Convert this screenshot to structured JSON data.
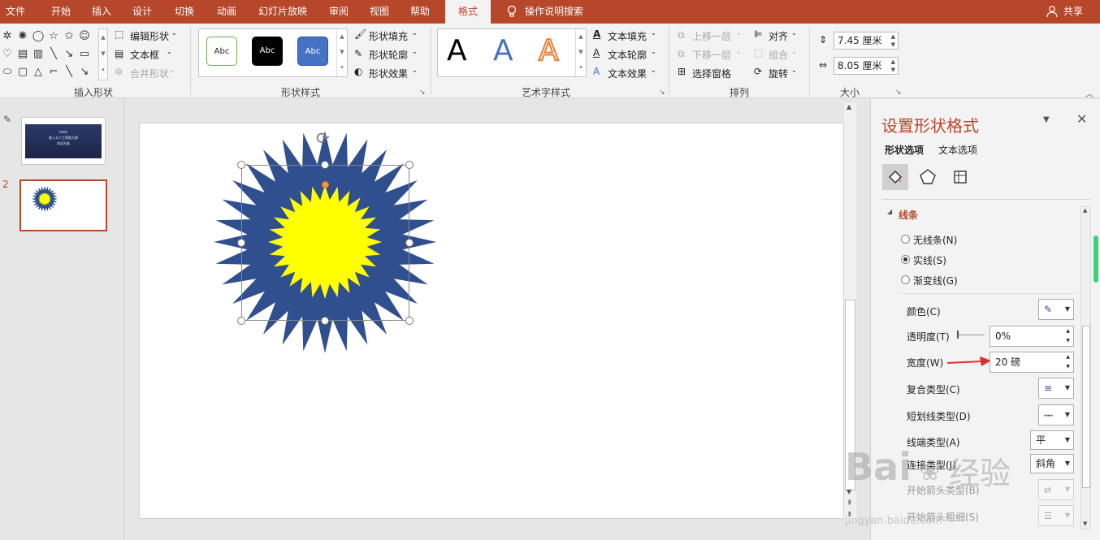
{
  "menu": {
    "items": [
      "文件",
      "开始",
      "插入",
      "设计",
      "切换",
      "动画",
      "幻灯片放映",
      "审阅",
      "视图",
      "帮助",
      "格式"
    ],
    "active": "格式",
    "search": "操作说明搜索",
    "share": "共享"
  },
  "ribbon": {
    "insert_shapes": {
      "label": "插入形状",
      "edit_shape": "编辑形状",
      "text_box": "文本框",
      "merge_shapes": "合并形状"
    },
    "shape_styles": {
      "label": "形状样式",
      "samples": [
        "Abc",
        "Abc",
        "Abc"
      ],
      "fill": "形状填充",
      "outline": "形状轮廓",
      "effects": "形状效果"
    },
    "wordart": {
      "label": "艺术字样式",
      "samples": [
        "A",
        "A",
        "A"
      ],
      "text_fill": "文本填充",
      "text_outline": "文本轮廓",
      "text_effects": "文本效果"
    },
    "arrange": {
      "label": "排列",
      "bring_forward": "上移一层",
      "send_backward": "下移一层",
      "selection_pane": "选择窗格",
      "align": "对齐",
      "group": "组合",
      "rotate": "旋转"
    },
    "size": {
      "label": "大小",
      "height": "7.45 厘米",
      "width": "8.05 厘米"
    }
  },
  "slides": {
    "thumb1_text": "Hello\n嵌入式人工智能大赛\n欢迎光临",
    "current_number": "2"
  },
  "panel": {
    "title": "设置形状格式",
    "tabs": [
      "形状选项",
      "文本选项"
    ],
    "section": "线条",
    "radios": [
      "无线条(N)",
      "实线(S)",
      "渐变线(G)"
    ],
    "selected_radio": "实线(S)",
    "color_label": "颜色(C)",
    "transparency_label": "透明度(T)",
    "transparency_value": "0%",
    "width_label": "宽度(W)",
    "width_value": "20 磅",
    "compound_label": "复合类型(C)",
    "dash_label": "短划线类型(D)",
    "cap_label": "线端类型(A)",
    "cap_value": "平",
    "join_label": "连接类型(J)",
    "join_value": "斜角",
    "begin_arrow_type": "开始箭头类型(B)",
    "begin_arrow_size": "开始箭头粗细(S)"
  },
  "watermark": {
    "brand": "Bai",
    "brand2": "经验",
    "url": "jingyan.baidu.com"
  },
  "colors": {
    "title_bar": "#b7472a",
    "shape_outline": "#2f4f8f",
    "shape_fill": "#ffff00",
    "accent_red": "#c0392b"
  }
}
